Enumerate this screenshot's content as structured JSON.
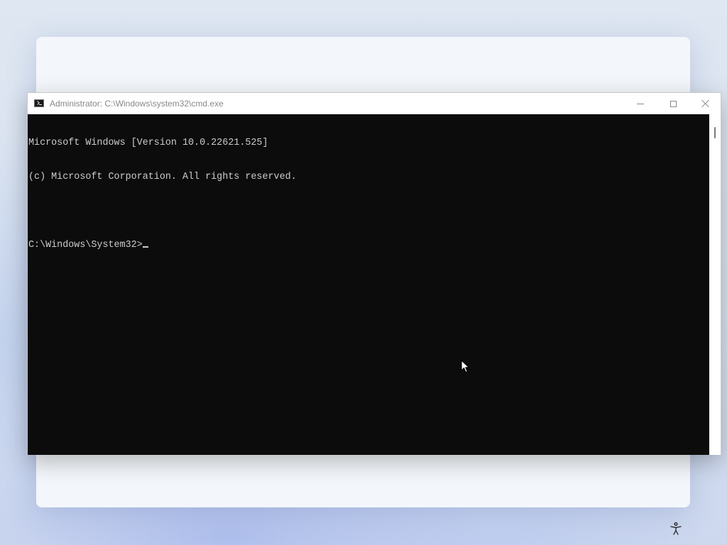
{
  "window": {
    "title": "Administrator: C:\\Windows\\system32\\cmd.exe",
    "app_icon": "cmd-icon",
    "caption_buttons": {
      "minimize": "minimize-icon",
      "maximize": "maximize-icon",
      "close": "close-icon"
    }
  },
  "console": {
    "lines": [
      "Microsoft Windows [Version 10.0.22621.525]",
      "(c) Microsoft Corporation. All rights reserved.",
      "",
      "C:\\Windows\\System32>"
    ],
    "background_color": "#0c0c0c",
    "text_color": "#cccccc"
  },
  "desktop": {
    "accessibility_icon": "accessibility-icon",
    "pointer_icon": "mouse-pointer-icon"
  }
}
